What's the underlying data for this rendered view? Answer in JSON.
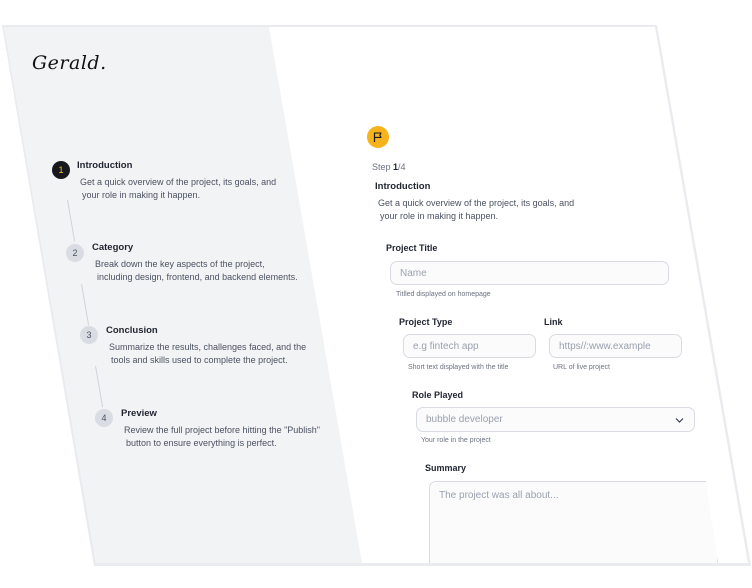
{
  "brand": {
    "logo": "Gerald."
  },
  "steps": [
    {
      "number": "1",
      "title": "Introduction",
      "desc_line1": "Get a quick overview of the project, its goals, and",
      "desc_line2": "your role in making it happen."
    },
    {
      "number": "2",
      "title": "Category",
      "desc_line1": "Break down the key aspects of the project,",
      "desc_line2": "including design, frontend, and backend elements."
    },
    {
      "number": "3",
      "title": "Conclusion",
      "desc_line1": "Summarize the results, challenges faced, and the",
      "desc_line2": "tools and skills used to complete the project."
    },
    {
      "number": "4",
      "title": "Preview",
      "desc_line1": "Review the full project before hitting the \"Publish\"",
      "desc_line2": "button to ensure everything is perfect."
    }
  ],
  "form": {
    "flag_icon": "flag-icon",
    "step_prefix": "Step ",
    "step_current": "1",
    "step_total": "/4",
    "section_title": "Introduction",
    "section_desc_line1": "Get a quick overview of the project, its goals, and",
    "section_desc_line2": "your role in making it happen.",
    "project_title": {
      "label": "Project Title",
      "placeholder": "Name",
      "hint": "Titlled displayed on homepage"
    },
    "project_type": {
      "label": "Project Type",
      "placeholder": "e.g fintech app",
      "hint": "Short text displayed with the title"
    },
    "link": {
      "label": "Link",
      "placeholder": "https//:www.example",
      "hint": "URL of live project"
    },
    "role_played": {
      "label": "Role Played",
      "value": "bubble developer",
      "hint": "Your role in the project"
    },
    "summary": {
      "label": "Summary",
      "placeholder": "The project was all about..."
    }
  },
  "colors": {
    "accent": "#f6b31b",
    "active_step": "#16181d",
    "panel": "#f2f3f5"
  }
}
